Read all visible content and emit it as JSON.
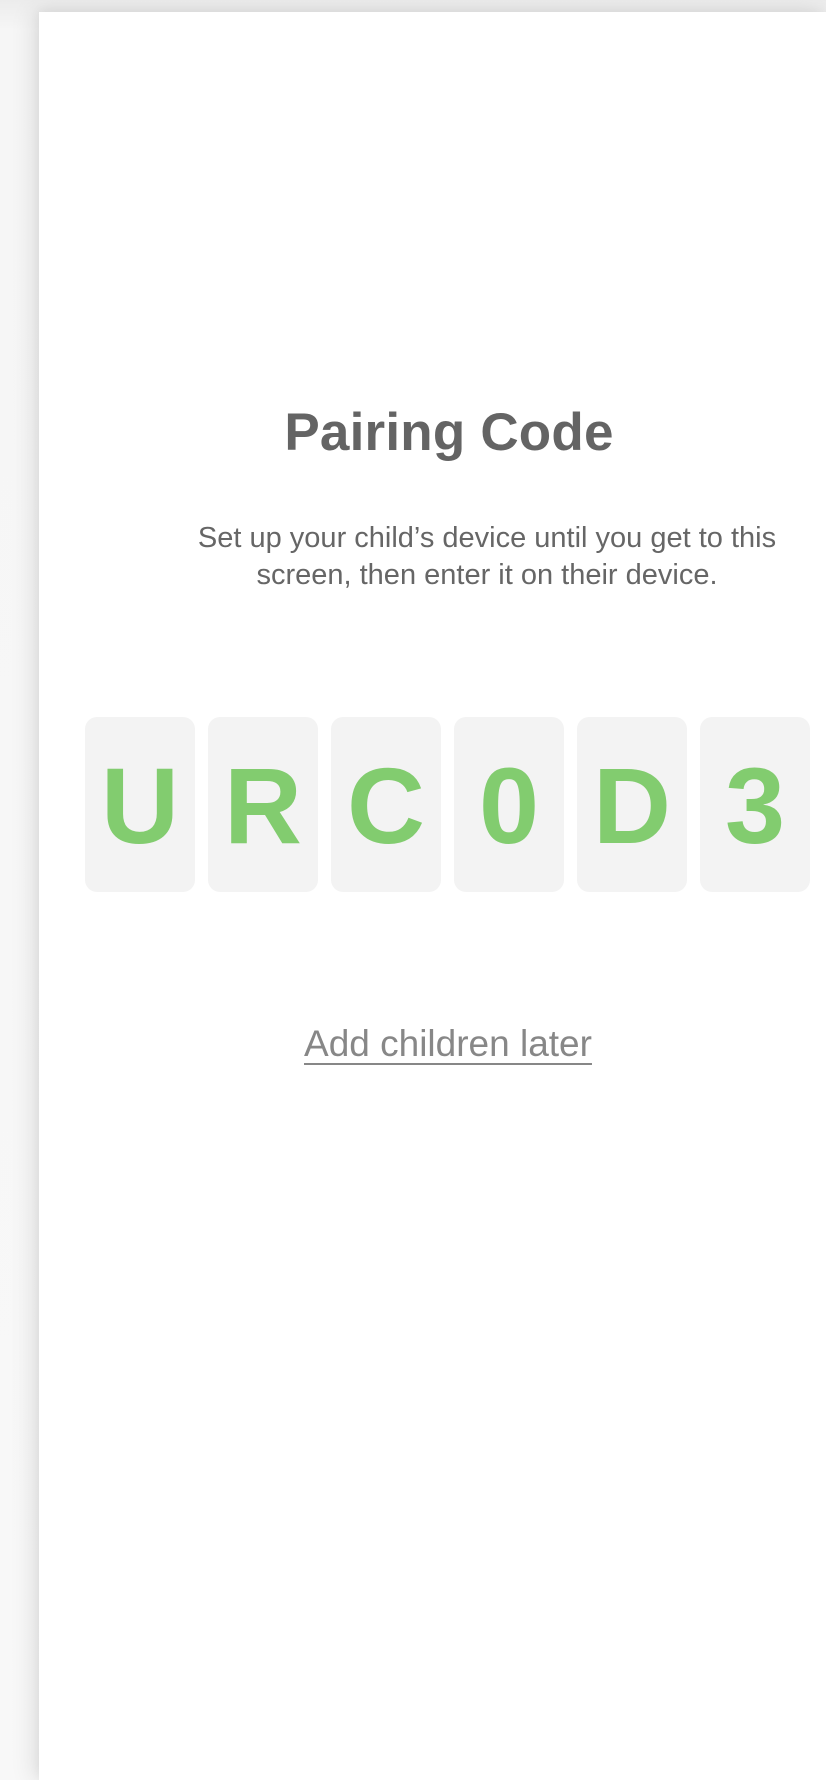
{
  "header": {
    "title": "Pairing Code"
  },
  "instructions": {
    "text": "Set up your child’s device until you get to this screen, then enter it on their device."
  },
  "pairing_code": {
    "characters": [
      "U",
      "R",
      "C",
      "0",
      "D",
      "3"
    ]
  },
  "actions": {
    "add_children_later": "Add children later"
  },
  "colors": {
    "code_accent": "#82cc6f",
    "code_box_bg": "#f3f3f3",
    "title_text": "#646464",
    "body_text": "#666666",
    "link_text": "#878787"
  }
}
